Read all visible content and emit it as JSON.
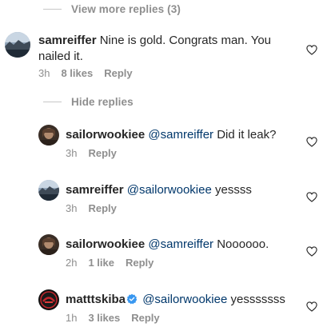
{
  "thread_controls": {
    "view_more": "View more replies (3)",
    "hide": "Hide replies"
  },
  "comments": [
    {
      "username": "samreiffer",
      "mention": "",
      "text": "Nine is gold. Congrats man. You nailed it.",
      "time": "3h",
      "likes": "8 likes",
      "reply": "Reply",
      "avatar_icon": "avatar-landscape"
    },
    {
      "username": "sailorwookiee",
      "mention": "@samreiffer",
      "text": "Did it leak?",
      "time": "3h",
      "likes": "",
      "reply": "Reply",
      "avatar_icon": "avatar-portrait"
    },
    {
      "username": "samreiffer",
      "mention": "@sailorwookiee",
      "text": "yessss",
      "time": "3h",
      "likes": "",
      "reply": "Reply",
      "avatar_icon": "avatar-landscape"
    },
    {
      "username": "sailorwookiee",
      "mention": "@samreiffer",
      "text": "Noooooo.",
      "time": "2h",
      "likes": "1 like",
      "reply": "Reply",
      "avatar_icon": "avatar-portrait"
    },
    {
      "username": "matttskiba",
      "mention": "@sailorwookiee",
      "text": "yesssssss",
      "time": "1h",
      "likes": "3 likes",
      "reply": "Reply",
      "verified": true,
      "avatar_icon": "avatar-logo"
    }
  ],
  "colors": {
    "text": "#262626",
    "secondary": "#8e8e8e",
    "mention": "#00376b",
    "verified": "#3897f0"
  }
}
